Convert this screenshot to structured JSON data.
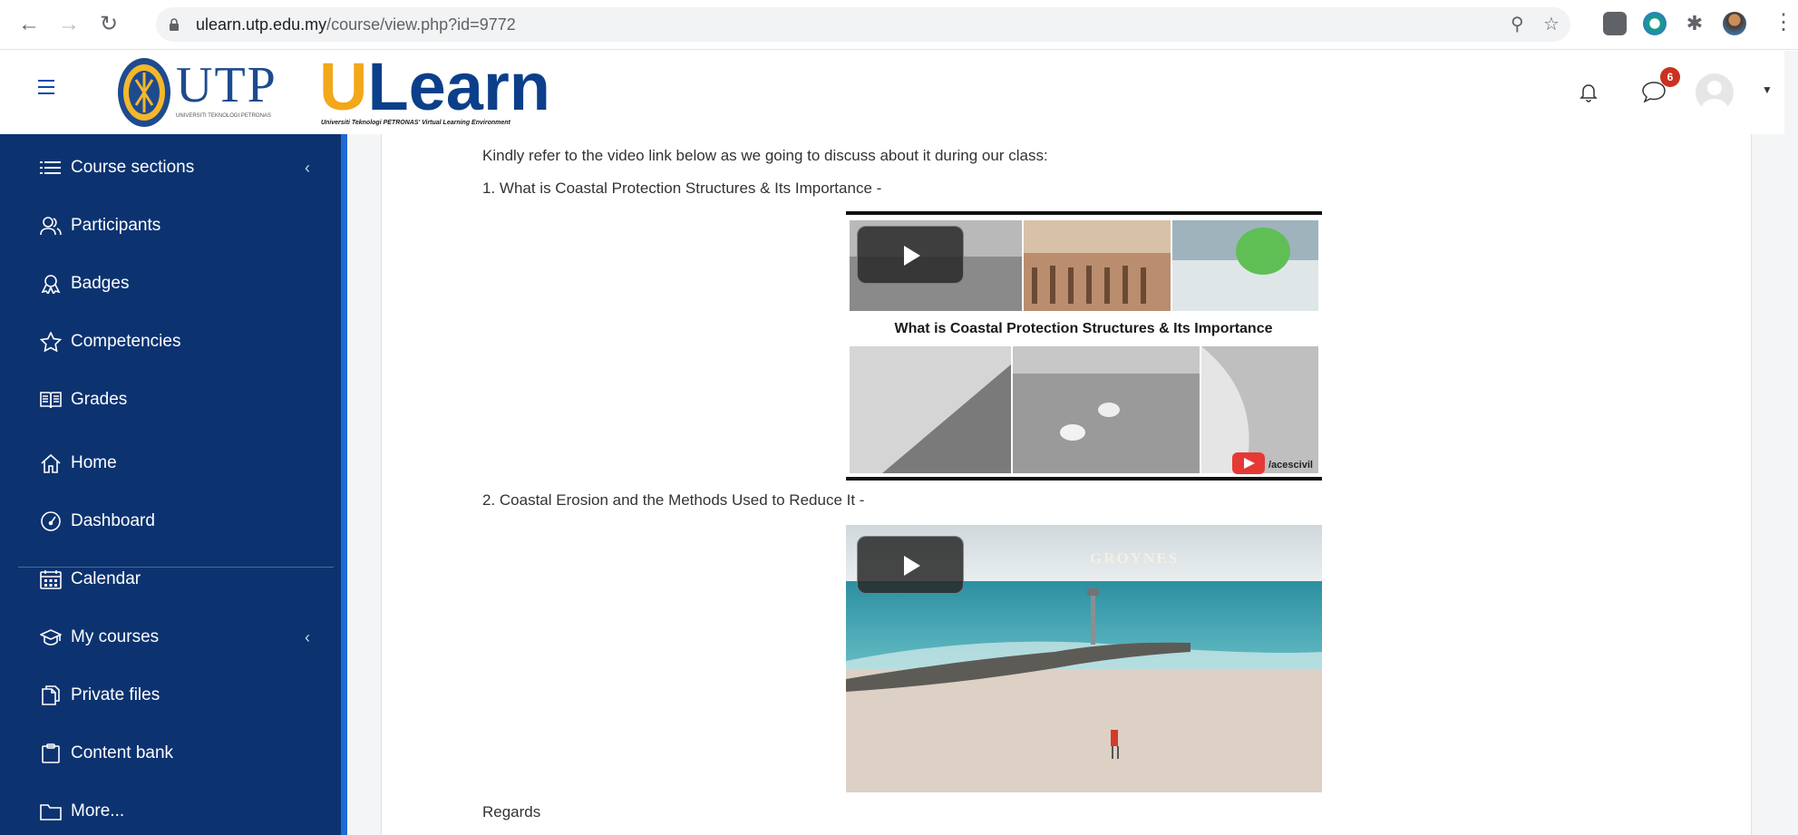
{
  "browser": {
    "url_host": "ulearn.utp.edu.my",
    "url_path": "/course/view.php?id=9772"
  },
  "navbar": {
    "logo_utp": "UTP",
    "logo_ulearn_u": "U",
    "logo_ulearn_rest": "Learn",
    "logo_utp_sub": "UNIVERSITI TEKNOLOGI PETRONAS",
    "logo_ulearn_sub": "Universiti Teknologi PETRONAS' Virtual Learning Environment",
    "message_count": "6"
  },
  "sidebar": {
    "items": [
      {
        "label": "Course sections"
      },
      {
        "label": "Participants"
      },
      {
        "label": "Badges"
      },
      {
        "label": "Competencies"
      },
      {
        "label": "Grades"
      },
      {
        "label": "Home"
      },
      {
        "label": "Dashboard"
      },
      {
        "label": "Calendar"
      },
      {
        "label": "My courses"
      },
      {
        "label": "Private files"
      },
      {
        "label": "Content bank"
      },
      {
        "label": "More..."
      }
    ]
  },
  "main": {
    "intro": "Kindly refer to the video link below as we going to discuss about it during our class:",
    "item1": "1. What is Coastal Protection Structures & Its Importance -",
    "item2": "2. Coastal Erosion and the Methods Used to Reduce It -",
    "closing": "Regards",
    "video1": {
      "caption": "What is Coastal Protection Structures & Its Importance",
      "channel": "/acescivil"
    },
    "video2": {
      "caption": "GROYNES"
    }
  },
  "colors": {
    "sidebar_bg": "#0c3370",
    "sidebar_accent": "#1e6bd6",
    "brand_orange": "#f3a71a",
    "brand_blue": "#0c3f8a",
    "badge_red": "#ca3120"
  }
}
